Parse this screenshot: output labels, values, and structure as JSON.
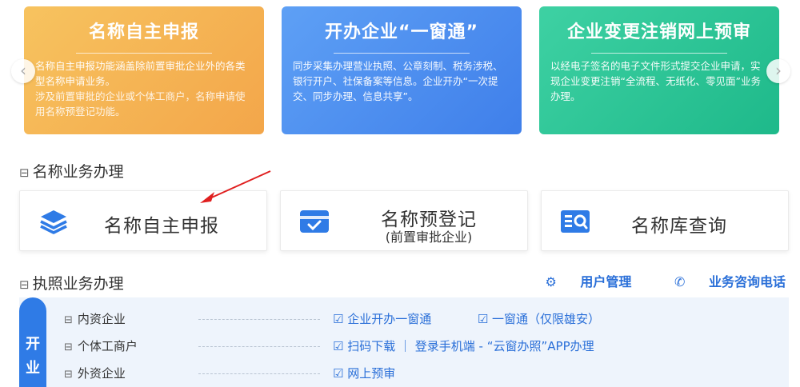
{
  "banners": [
    {
      "title": "名称自主申报",
      "desc": "名称自主申报功能涵盖除前置审批企业外的各类型名称申请业务。",
      "desc2": "涉及前置审批的企业或个体工商户，名称申请使用名称预登记功能。"
    },
    {
      "title": "开办企业“一窗通”",
      "desc": "同步采集办理营业执照、公章刻制、税务涉税、银行开户、社保备案等信息。企业开办“一次提交、同步办理、信息共享”。"
    },
    {
      "title": "企业变更注销网上预审",
      "desc": "以经电子签名的电子文件形式提交企业申请，实现企业变更注销“全流程、无纸化、零见面”业务办理。"
    }
  ],
  "name_section": {
    "title": "名称业务办理",
    "cards": [
      {
        "label": "名称自主申报"
      },
      {
        "label": "名称预登记",
        "sub": "(前置审批企业)"
      },
      {
        "label": "名称库查询"
      }
    ]
  },
  "license_section": {
    "title": "执照业务办理",
    "user_mgmt": "用户管理",
    "hotline": "业务咨询电话",
    "side_label": "开业",
    "rows": [
      {
        "name": "内资企业",
        "actions": [
          "企业开办一窗通",
          "一窗通（仅限雄安）"
        ]
      },
      {
        "name": "个体工商户",
        "actions": [
          "扫码下载 ｜ 登录手机端 - “云窗办照”APP办理"
        ]
      },
      {
        "name": "外资企业",
        "actions": [
          "网上预审"
        ]
      }
    ]
  },
  "colors": {
    "accent": "#2a6fd8",
    "orange": "#f3a64a",
    "blue": "#3f7fea",
    "green": "#1eb98a"
  }
}
